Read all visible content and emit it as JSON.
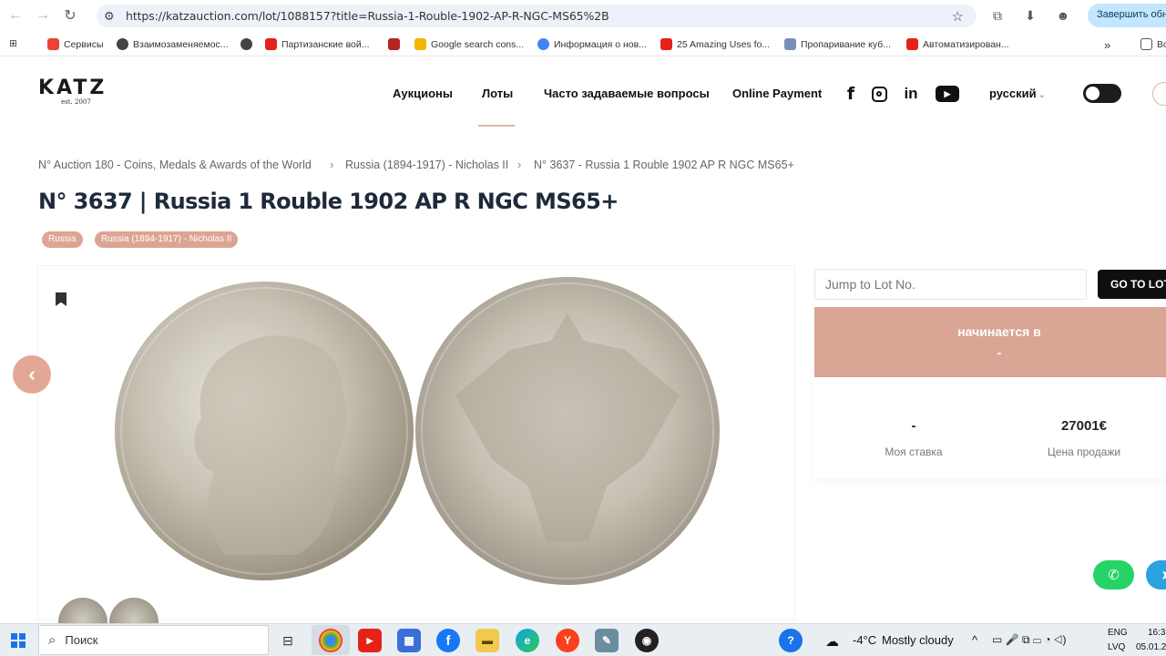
{
  "browser": {
    "url": "https://katzauction.com/lot/1088157?title=Russia-1-Rouble-1902-AP-R-NGC-MS65%2B",
    "finish_label": "Завершить обно",
    "bookmarks": [
      {
        "label": "Сервисы",
        "color": "#ea4335"
      },
      {
        "label": "Взаимозаменяемос...",
        "color": "#444444"
      },
      {
        "label": "",
        "color": "#444444"
      },
      {
        "label": "Партизанские вой...",
        "color": "#e62117"
      },
      {
        "label": "",
        "color": "#b3261e"
      },
      {
        "label": "Google search cons...",
        "color": "#f4b400"
      },
      {
        "label": "Информация о нов...",
        "color": "#4285f4"
      },
      {
        "label": "25 Amazing Uses fo...",
        "color": "#e62117"
      },
      {
        "label": "Пропаривание куб...",
        "color": "#7a8fb8"
      },
      {
        "label": "Автоматизирован...",
        "color": "#e62117"
      }
    ],
    "more": "»",
    "all_bookmarks": "Вс"
  },
  "site": {
    "logo": "KATZ",
    "logo_sub": "est. 2007",
    "nav": [
      "Аукционы",
      "Лоты",
      "Часто задаваемые вопросы",
      "Online Payment"
    ],
    "language": "русский",
    "social": [
      "facebook",
      "instagram",
      "linkedin",
      "youtube"
    ]
  },
  "breadcrumb": [
    "N° Auction 180 - Coins, Medals & Awards of the World",
    "Russia (1894-1917) - Nicholas II",
    "N° 3637 - Russia 1 Rouble 1902 AP R NGC MS65+"
  ],
  "lot": {
    "title": "N° 3637 | Russia 1 Rouble 1902 AP R NGC MS65+",
    "tags": [
      "Russia",
      "Russia (1894-1917) - Nicholas II"
    ]
  },
  "sidebar": {
    "jump_placeholder": "Jump to Lot No.",
    "go_label": "GO TO LOT",
    "status_label": "начинается в",
    "status_value": "-",
    "my_bid_value": "-",
    "my_bid_label": "Моя ставка",
    "sale_price_value": "27001€",
    "sale_price_label": "Цена продажи"
  },
  "taskbar": {
    "search": "Поиск",
    "weather_temp": "-4°C",
    "weather_text": "Mostly cloudy",
    "lang_top": "ENG",
    "lang_bottom": "LVQ",
    "time": "16:3",
    "date": "05.01.2"
  }
}
